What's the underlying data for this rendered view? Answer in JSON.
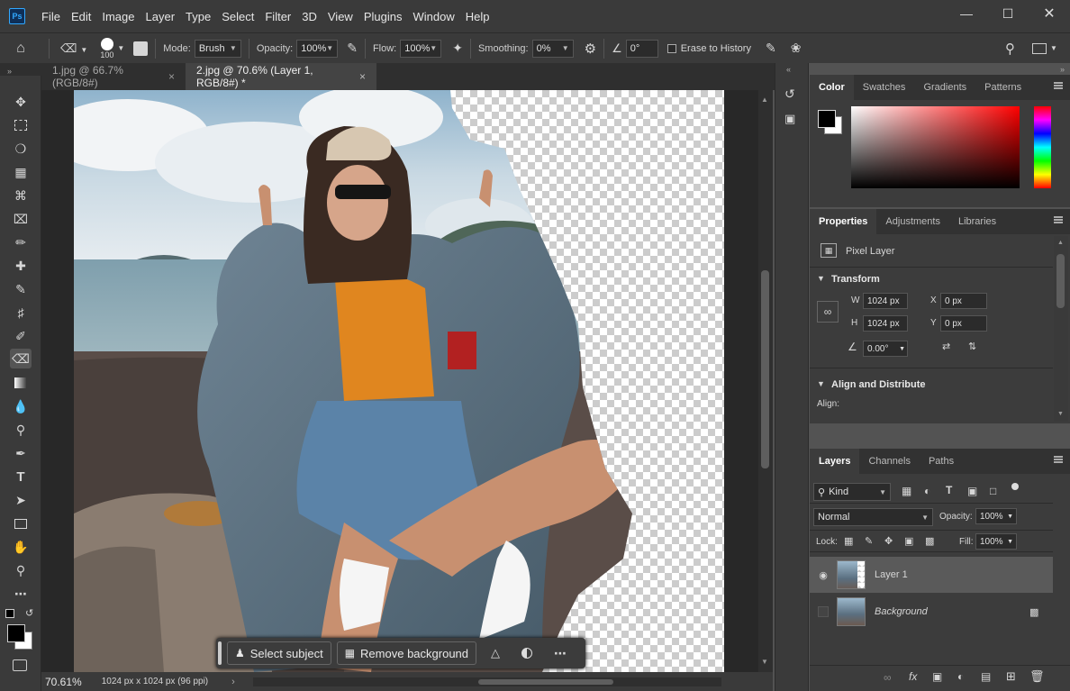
{
  "menubar": {
    "app_logo": "Ps",
    "items": [
      "File",
      "Edit",
      "Image",
      "Layer",
      "Type",
      "Select",
      "Filter",
      "3D",
      "View",
      "Plugins",
      "Window",
      "Help"
    ]
  },
  "options": {
    "brush_size": "100",
    "mode_label": "Mode:",
    "mode_value": "Brush",
    "opacity_label": "Opacity:",
    "opacity_value": "100%",
    "flow_label": "Flow:",
    "flow_value": "100%",
    "smoothing_label": "Smoothing:",
    "smoothing_value": "0%",
    "angle_value": "0°",
    "erase_history_label": "Erase to History"
  },
  "doc_tabs": [
    {
      "label": "1.jpg @ 66.7% (RGB/8#)"
    },
    {
      "label": "2.jpg @ 70.6% (Layer 1, RGB/8#) *"
    }
  ],
  "status": {
    "zoom": "70.61%",
    "doc_info": "1024 px x 1024 px (96 ppi)"
  },
  "contextual_taskbar": {
    "select_subject": "Select subject",
    "remove_background": "Remove background"
  },
  "color_panel": {
    "tabs": [
      "Color",
      "Swatches",
      "Gradients",
      "Patterns"
    ],
    "foreground": "#000000",
    "background": "#ffffff",
    "hue_color": "#ff0000"
  },
  "properties_panel": {
    "tabs": [
      "Properties",
      "Adjustments",
      "Libraries"
    ],
    "layer_type": "Pixel Layer",
    "transform_title": "Transform",
    "w_label": "W",
    "w_value": "1024 px",
    "h_label": "H",
    "h_value": "1024 px",
    "x_label": "X",
    "x_value": "0 px",
    "y_label": "Y",
    "y_value": "0 px",
    "angle_value": "0.00°",
    "align_title": "Align and Distribute",
    "align_label": "Align:"
  },
  "layers_panel": {
    "tabs": [
      "Layers",
      "Channels",
      "Paths"
    ],
    "filter_kind": "Kind",
    "blend_mode": "Normal",
    "opacity_label": "Opacity:",
    "opacity_value": "100%",
    "lock_label": "Lock:",
    "fill_label": "Fill:",
    "fill_value": "100%",
    "layers": [
      {
        "name": "Layer 1",
        "visible": true,
        "selected": true
      },
      {
        "name": "Background",
        "visible": false,
        "selected": false
      }
    ]
  }
}
